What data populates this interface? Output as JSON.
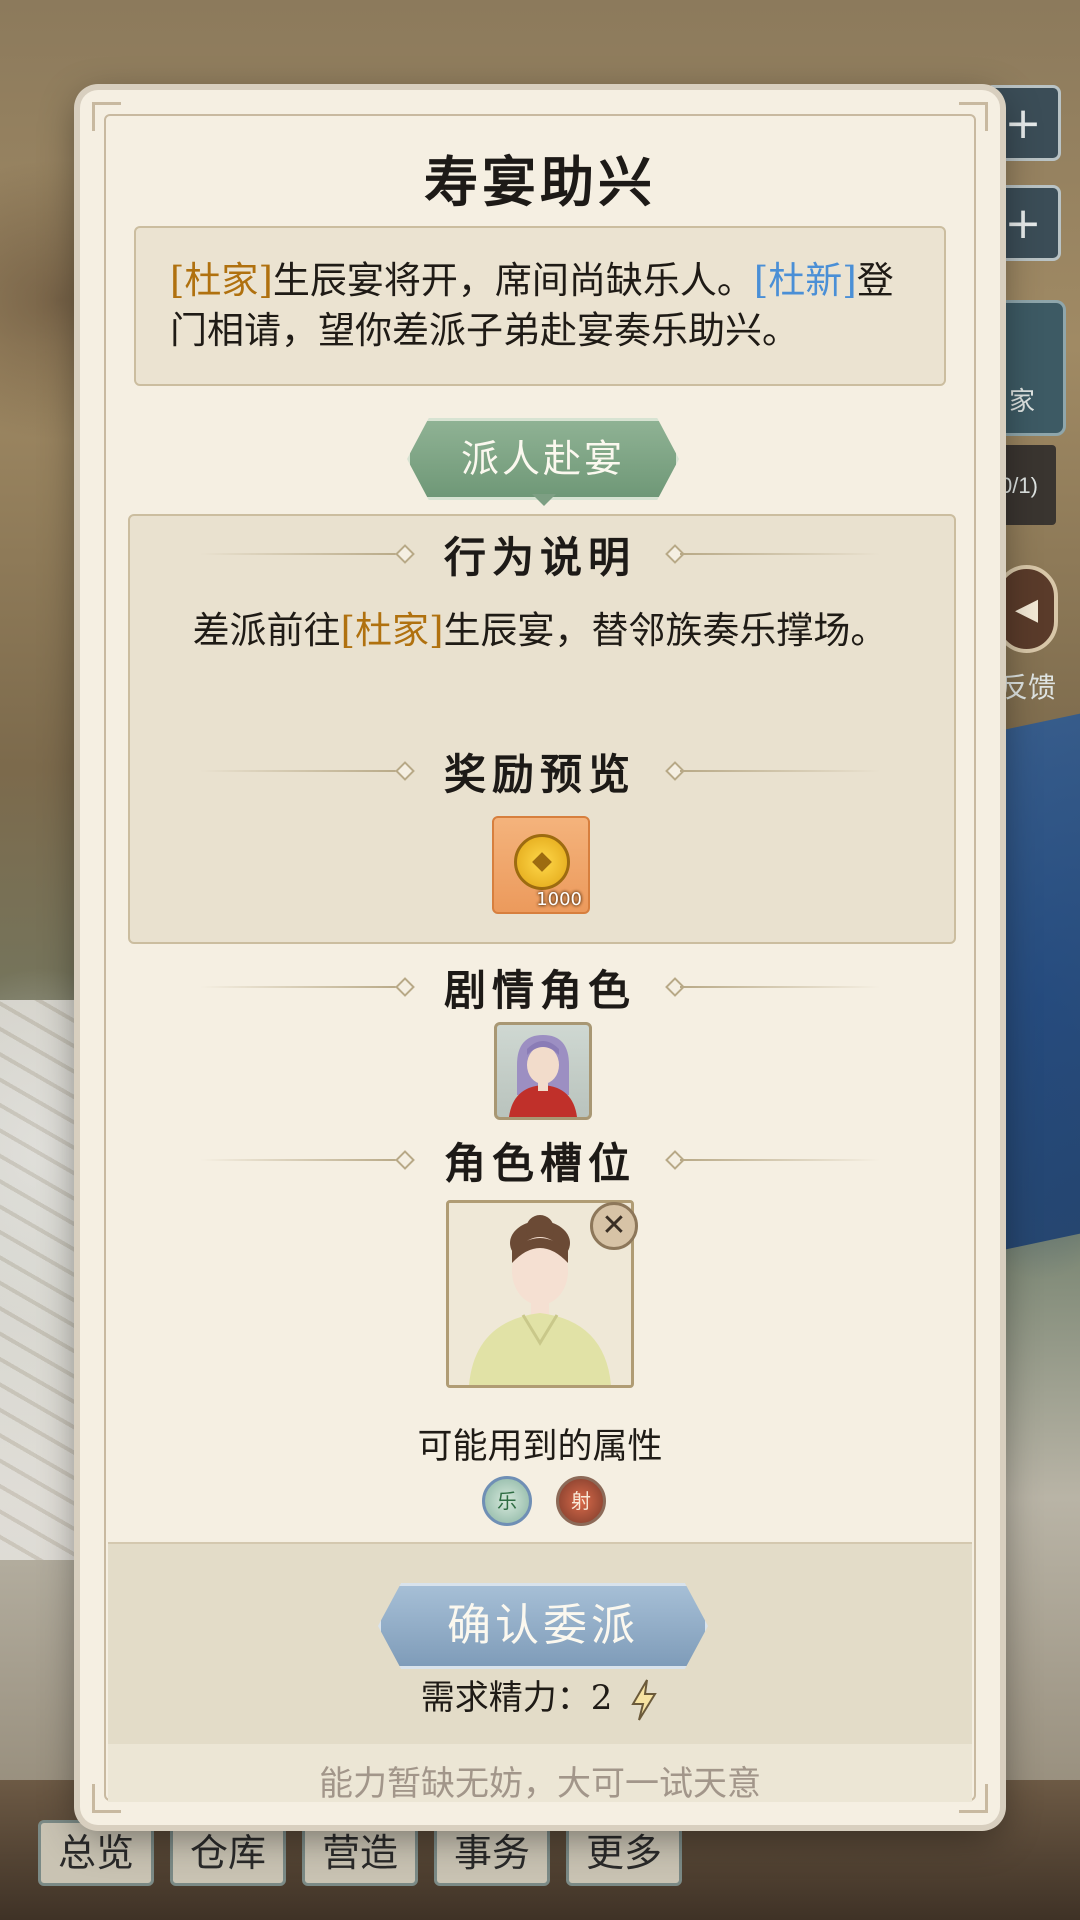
{
  "dialog": {
    "title": "寿宴助兴",
    "story": {
      "family_tag": "[杜家]",
      "text_part1": "生辰宴将开，席间尚缺乐人。",
      "person_tag": "[杜新]",
      "text_part2": "登门相请，望你差派子弟赴宴奏乐助兴。"
    },
    "action_tag": "派人赴宴",
    "behavior": {
      "heading": "行为说明",
      "prefix": "差派前往",
      "family_tag": "[杜家]",
      "suffix": "生辰宴，替邻族奏乐撑场。"
    },
    "reward": {
      "heading": "奖励预览",
      "items": [
        {
          "icon": "copper-coin-icon",
          "quantity": "1000"
        }
      ]
    },
    "story_role": {
      "heading": "剧情角色"
    },
    "role_slot": {
      "heading": "角色槽位"
    },
    "attributes": {
      "heading": "可能用到的属性",
      "items": [
        {
          "label": "乐",
          "icon": "music-attribute-icon"
        },
        {
          "label": "射",
          "icon": "archery-attribute-icon"
        }
      ]
    },
    "confirm_label": "确认委派",
    "energy": {
      "label": "需求精力：",
      "value": "2"
    },
    "hint": "能力暂缺无妨，大可一试天意"
  },
  "background": {
    "side_plus_1": "+",
    "side_plus_2": "+",
    "side_family_label": "家",
    "side_counter": "0/1)",
    "feedback_label": "反馈",
    "nav": [
      "总览",
      "仓库",
      "营造",
      "事务",
      "更多"
    ]
  },
  "colors": {
    "accent_brown": "#b0710f",
    "accent_blue": "#4a8fd6",
    "action_green": "#7d9f83",
    "confirm_blue": "#8fabc6",
    "panel_bg": "#f5efe2"
  }
}
